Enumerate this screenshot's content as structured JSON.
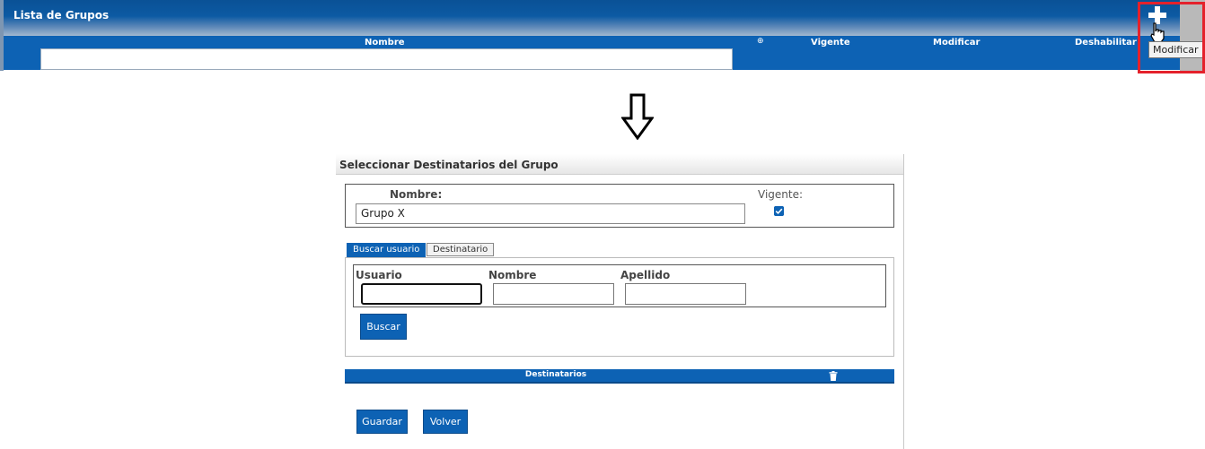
{
  "top": {
    "title": "Lista de Grupos",
    "columns": [
      "Nombre",
      "Vigente",
      "Modificar",
      "Deshabilitar"
    ],
    "sort_icon": "sort-icon",
    "add_icon": "plus-icon",
    "tooltip": "Modificar"
  },
  "form": {
    "title": "Seleccionar Destinatarios del Grupo",
    "nombre_label": "Nombre:",
    "nombre_value": "Grupo X",
    "vigente_label": "Vigente:",
    "vigente_checked": true,
    "tabs": [
      "Buscar usuario",
      "Destinatario"
    ],
    "search": {
      "usuario_label": "Usuario",
      "nombre_label": "Nombre",
      "apellido_label": "Apellido",
      "usuario_value": "",
      "nombre_value": "",
      "apellido_value": ""
    },
    "buscar_label": "Buscar",
    "destinatarios_title": "Destinatarios",
    "guardar_label": "Guardar",
    "volver_label": "Volver"
  },
  "colors": {
    "primary": "#0d62b4",
    "highlight": "#e4212b"
  }
}
